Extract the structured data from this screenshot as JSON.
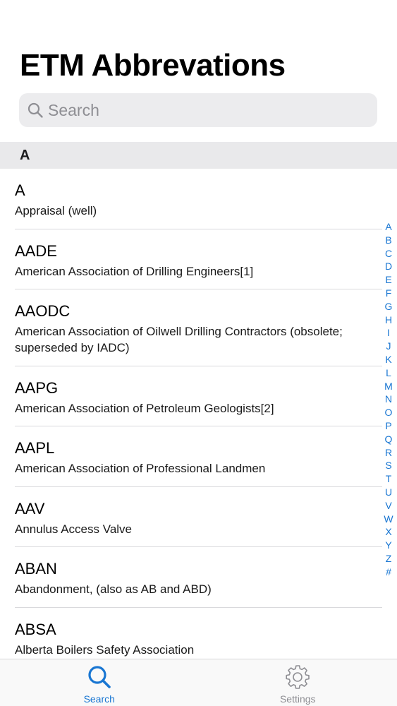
{
  "header": {
    "title": "ETM Abbrevations"
  },
  "search": {
    "placeholder": "Search",
    "value": ""
  },
  "sections": [
    {
      "letter": "A",
      "items": [
        {
          "abbr": "A",
          "desc": "Appraisal (well)"
        },
        {
          "abbr": "AADE",
          "desc": "American Association of Drilling Engineers[1]"
        },
        {
          "abbr": "AAODC",
          "desc": "American Association of Oilwell Drilling Contractors (obsolete; superseded by IADC)"
        },
        {
          "abbr": "AAPG",
          "desc": "American Association of Petroleum Geologists[2]"
        },
        {
          "abbr": "AAPL",
          "desc": "American Association of Professional Landmen"
        },
        {
          "abbr": "AAV",
          "desc": "Annulus Access Valve"
        },
        {
          "abbr": "ABAN",
          "desc": "Abandonment, (also as AB and ABD)"
        },
        {
          "abbr": "ABSA",
          "desc": "Alberta Boilers Safety Association"
        }
      ]
    }
  ],
  "index": [
    "A",
    "B",
    "C",
    "D",
    "E",
    "F",
    "G",
    "H",
    "I",
    "J",
    "K",
    "L",
    "M",
    "N",
    "O",
    "P",
    "Q",
    "R",
    "S",
    "T",
    "U",
    "V",
    "W",
    "X",
    "Y",
    "Z",
    "#"
  ],
  "tabs": [
    {
      "label": "Search",
      "icon": "search-icon",
      "active": true
    },
    {
      "label": "Settings",
      "icon": "gear-icon",
      "active": false
    }
  ],
  "colors": {
    "accent": "#1976d2",
    "inactive": "#8e8e93",
    "section_header_bg": "#e9e9eb",
    "search_bg": "#ececee"
  }
}
